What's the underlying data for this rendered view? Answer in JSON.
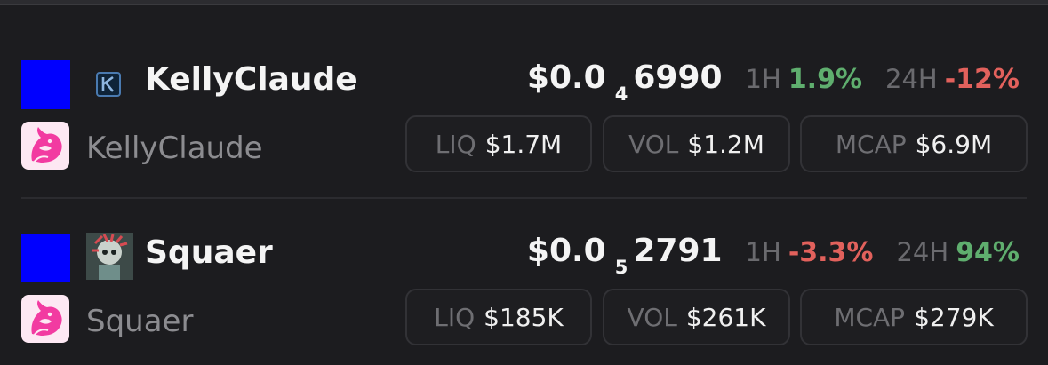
{
  "colors": {
    "background": "#1c1c1f",
    "positive": "#5fae6e",
    "negative": "#e2615c",
    "square": "#0000ff"
  },
  "tokens": [
    {
      "name": "KellyClaude",
      "dex_name": "KellyClaude",
      "token_icon": "k-logo-icon",
      "dex_icon": "uniswap-unicorn-icon",
      "price_prefix": "$0.0",
      "price_zeros": "4",
      "price_digits": "6990",
      "h1_label": "1H",
      "h1_change": "1.9%",
      "h1_direction": "up",
      "h24_label": "24H",
      "h24_change": "-12%",
      "h24_direction": "down",
      "liq_label": "LIQ",
      "liq_value": "$1.7M",
      "vol_label": "VOL",
      "vol_value": "$1.2M",
      "mcap_label": "MCAP",
      "mcap_value": "$6.9M"
    },
    {
      "name": "Squaer",
      "dex_name": "Squaer",
      "token_icon": "squaer-avatar-icon",
      "dex_icon": "uniswap-unicorn-icon",
      "price_prefix": "$0.0",
      "price_zeros": "5",
      "price_digits": "2791",
      "h1_label": "1H",
      "h1_change": "-3.3%",
      "h1_direction": "down",
      "h24_label": "24H",
      "h24_change": "94%",
      "h24_direction": "up",
      "liq_label": "LIQ",
      "liq_value": "$185K",
      "vol_label": "VOL",
      "vol_value": "$261K",
      "mcap_label": "MCAP",
      "mcap_value": "$279K"
    }
  ]
}
